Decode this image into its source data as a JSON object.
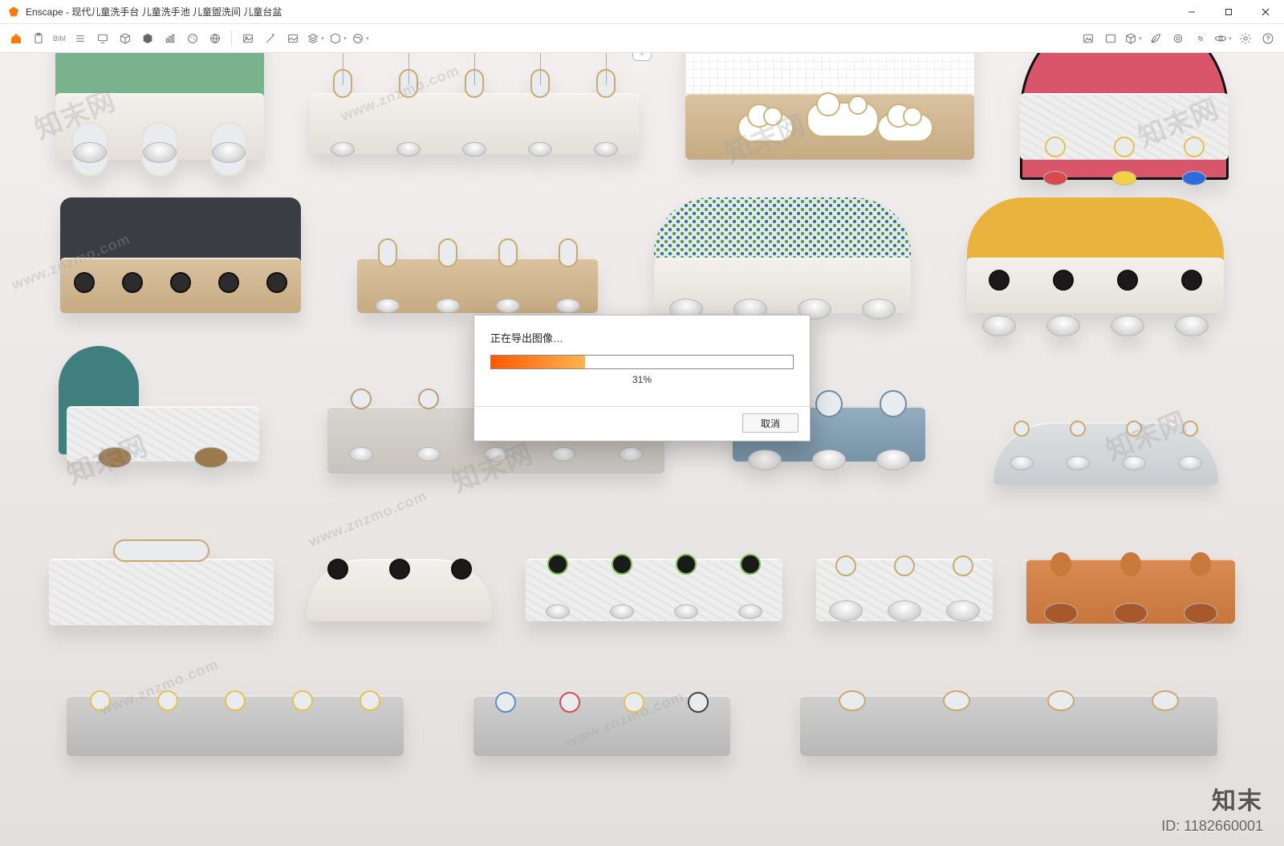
{
  "titlebar": {
    "app_name": "Enscape",
    "document_title": "现代儿童洗手台 儿童洗手池 儿童盥洗间 儿童台盆",
    "minimize_tooltip": "Minimize",
    "maximize_tooltip": "Maximize",
    "close_tooltip": "Close"
  },
  "toolbar": {
    "home": "home",
    "bim": "BIM",
    "icons_left": [
      "clipboard-icon",
      "list-icon",
      "monitor-icon",
      "cube-outline-icon",
      "cube-solid-icon",
      "stats-icon",
      "palette-icon",
      "globe-icon"
    ],
    "icons_center": [
      "image-icon",
      "magic-wand-icon",
      "image-alt-icon",
      "layers-icon",
      "cube-dd-icon",
      "earth-dd-icon"
    ],
    "icons_right": [
      "image-mountain-icon",
      "image-outline-icon",
      "cube-grid-icon",
      "leaf-icon",
      "target-icon",
      "link-icon",
      "eye-icon",
      "gear-icon",
      "help-icon"
    ]
  },
  "dialog": {
    "title": "正在导出图像…",
    "percent_label": "31%",
    "percent_value": 31,
    "cancel_label": "取消"
  },
  "branding": {
    "brand": "知末",
    "id_label": "ID: 1182660001"
  },
  "watermarks": {
    "text_cn": "知末网",
    "text_en": "www.znzmo.com"
  },
  "pulltab_glyph": "⌃"
}
